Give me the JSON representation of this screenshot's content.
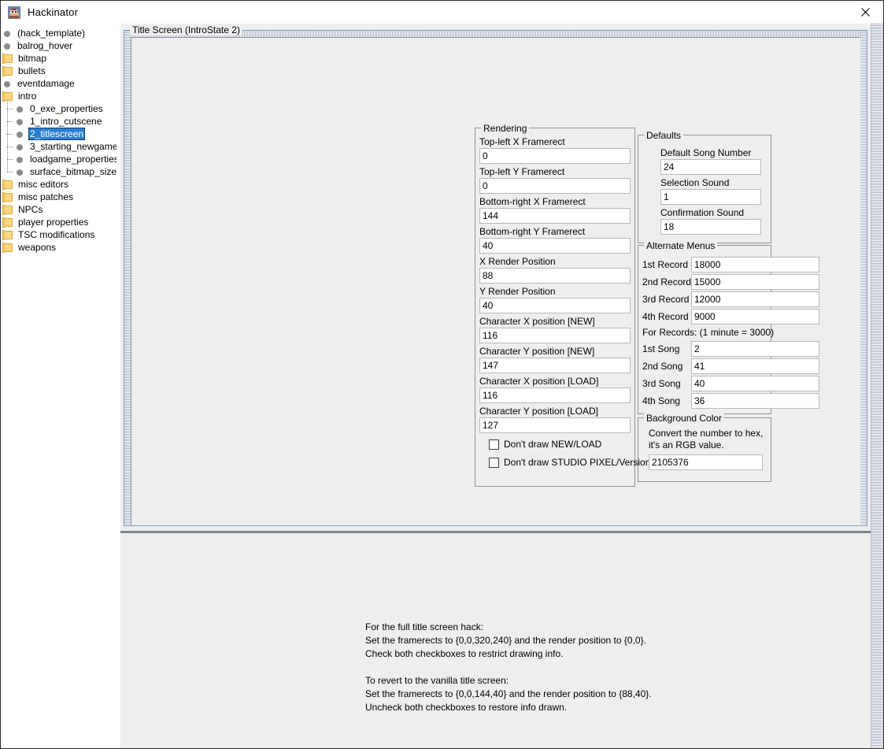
{
  "window": {
    "title": "Hackinator",
    "app_icon": "hackinator-app-icon",
    "close_label": "×"
  },
  "sidebar": {
    "items": [
      {
        "label": "(hack_template)",
        "icon": "bullet-icon",
        "type": "leaf",
        "depth": 0,
        "selected": false
      },
      {
        "label": "balrog_hover",
        "icon": "bullet-icon",
        "type": "leaf",
        "depth": 0,
        "selected": false
      },
      {
        "label": "bitmap",
        "icon": "folder-icon",
        "type": "folder",
        "depth": 0,
        "selected": false
      },
      {
        "label": "bullets",
        "icon": "folder-icon",
        "type": "folder",
        "depth": 0,
        "selected": false
      },
      {
        "label": "eventdamage",
        "icon": "bullet-icon",
        "type": "leaf",
        "depth": 0,
        "selected": false
      },
      {
        "label": "intro",
        "icon": "folder-icon",
        "type": "folder",
        "depth": 0,
        "selected": false
      },
      {
        "label": "0_exe_properties",
        "icon": "bullet-icon",
        "type": "leaf",
        "depth": 1,
        "selected": false
      },
      {
        "label": "1_intro_cutscene",
        "icon": "bullet-icon",
        "type": "leaf",
        "depth": 1,
        "selected": false
      },
      {
        "label": "2_titlescreen",
        "icon": "bullet-icon",
        "type": "leaf",
        "depth": 1,
        "selected": true
      },
      {
        "label": "3_starting_newgame",
        "icon": "bullet-icon",
        "type": "leaf",
        "depth": 1,
        "selected": false
      },
      {
        "label": "loadgame_properties",
        "icon": "bullet-icon",
        "type": "leaf",
        "depth": 1,
        "selected": false
      },
      {
        "label": "surface_bitmap_sizes",
        "icon": "bullet-icon",
        "type": "leaf",
        "depth": 1,
        "selected": false,
        "last": true
      },
      {
        "label": "misc editors",
        "icon": "folder-icon",
        "type": "folder",
        "depth": 0,
        "selected": false
      },
      {
        "label": "misc patches",
        "icon": "folder-icon",
        "type": "folder",
        "depth": 0,
        "selected": false
      },
      {
        "label": "NPCs",
        "icon": "folder-icon",
        "type": "folder",
        "depth": 0,
        "selected": false
      },
      {
        "label": "player properties",
        "icon": "folder-icon",
        "type": "folder",
        "depth": 0,
        "selected": false
      },
      {
        "label": "TSC modifications",
        "icon": "folder-icon",
        "type": "folder",
        "depth": 0,
        "selected": false
      },
      {
        "label": "weapons",
        "icon": "folder-icon",
        "type": "folder",
        "depth": 0,
        "selected": false
      }
    ]
  },
  "main": {
    "group_title": "Title Screen (IntroState 2)",
    "rendering": {
      "legend": "Rendering",
      "fields": [
        {
          "label": "Top-left X Framerect",
          "value": "0"
        },
        {
          "label": "Top-left Y Framerect",
          "value": "0"
        },
        {
          "label": "Bottom-right X Framerect",
          "value": "144"
        },
        {
          "label": "Bottom-right Y Framerect",
          "value": "40"
        },
        {
          "label": "X Render Position",
          "value": "88"
        },
        {
          "label": "Y Render Position",
          "value": "40"
        },
        {
          "label": "Character X position [NEW]",
          "value": "116"
        },
        {
          "label": "Character Y position [NEW]",
          "value": "147"
        },
        {
          "label": "Character X position [LOAD]",
          "value": "116"
        },
        {
          "label": "Character Y position [LOAD]",
          "value": "127"
        }
      ],
      "checkboxes": [
        {
          "label": "Don't draw NEW/LOAD",
          "checked": false
        },
        {
          "label": "Don't draw STUDIO PIXEL/Version",
          "checked": false
        }
      ]
    },
    "defaults": {
      "legend": "Defaults",
      "fields": [
        {
          "label": "Default Song Number",
          "value": "24"
        },
        {
          "label": "Selection Sound",
          "value": "1"
        },
        {
          "label": "Confirmation Sound",
          "value": "18"
        }
      ]
    },
    "alternate_menus": {
      "legend": "Alternate Menus",
      "records": [
        {
          "label": "1st Record",
          "value": "18000"
        },
        {
          "label": "2nd Record",
          "value": "15000"
        },
        {
          "label": "3rd Record",
          "value": "12000"
        },
        {
          "label": "4th Record",
          "value": "9000"
        }
      ],
      "note": "For Records: (1 minute = 3000)",
      "songs": [
        {
          "label": "1st Song",
          "value": "2"
        },
        {
          "label": "2nd Song",
          "value": "41"
        },
        {
          "label": "3rd Song",
          "value": "40"
        },
        {
          "label": "4th Song",
          "value": "36"
        }
      ]
    },
    "background_color": {
      "legend": "Background Color",
      "hint_line1": "Convert the number to hex,",
      "hint_line2": "it's an RGB value.",
      "value": "2105376"
    }
  },
  "help": {
    "lines": [
      "For the full title screen hack:",
      "Set the framerects to {0,0,320,240} and the render position to {0,0}.",
      "Check both checkboxes to restrict drawing info.",
      "",
      "To revert to the vanilla title screen:",
      "Set the framerects to {0,0,144,40} and the render position to {88,40}.",
      "Uncheck both checkboxes to restore info drawn."
    ]
  },
  "colors": {
    "selection_blue": "#2a7fd4",
    "groupbox_border": "#7f9db9",
    "panel_bg": "#eeeeee",
    "divider": "#7c8494",
    "folder_yellow": "#fcd77f"
  }
}
